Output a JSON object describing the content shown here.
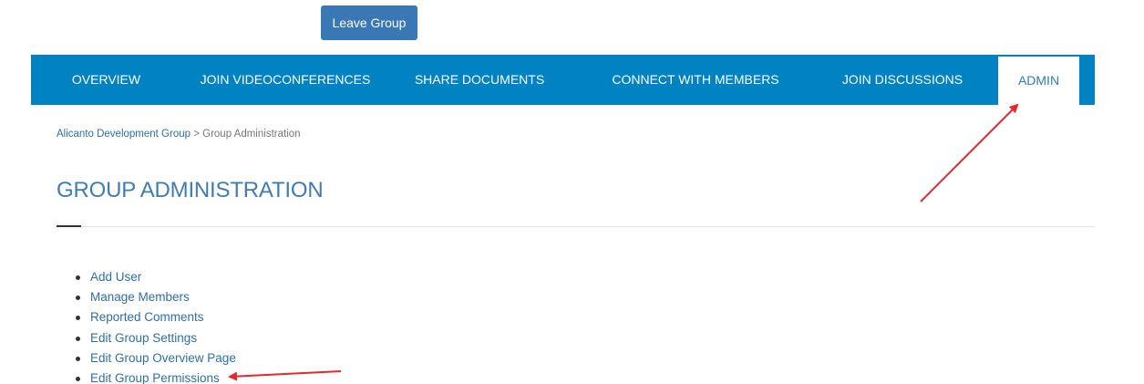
{
  "header": {
    "leave_group_label": "Leave Group"
  },
  "nav": {
    "items": [
      {
        "label": "OVERVIEW"
      },
      {
        "label": "JOIN VIDEOCONFERENCES"
      },
      {
        "label": "SHARE DOCUMENTS"
      },
      {
        "label": "CONNECT WITH MEMBERS"
      },
      {
        "label": "JOIN DISCUSSIONS"
      },
      {
        "label": "ADMIN",
        "active": true
      }
    ]
  },
  "breadcrumb": {
    "group": "Alicanto Development Group",
    "separator": " > ",
    "current": "Group Administration"
  },
  "page_title": "GROUP ADMINISTRATION",
  "admin_links": [
    {
      "label": "Add User"
    },
    {
      "label": "Manage Members"
    },
    {
      "label": "Reported Comments"
    },
    {
      "label": "Edit Group Settings"
    },
    {
      "label": "Edit Group Overview Page"
    },
    {
      "label": "Edit Group Permissions"
    }
  ],
  "colors": {
    "nav_background": "#0082c3",
    "button_background": "#3a78b5",
    "link": "#2e6fa8",
    "title": "#3f7cb4",
    "annotation_arrow": "#e8262b"
  }
}
